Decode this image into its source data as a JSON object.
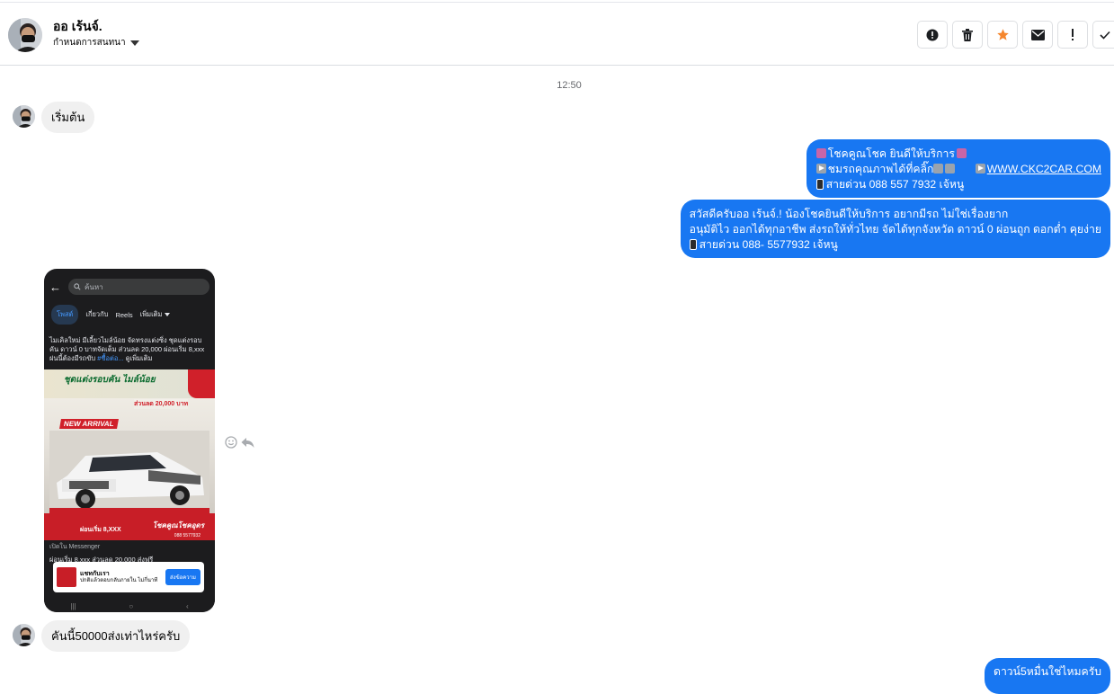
{
  "header": {
    "contact_name": "ออ เร้นจ์.",
    "subtitle": "กำหนดการสนทนา",
    "actions": [
      "report",
      "delete",
      "star",
      "mark-unread",
      "important",
      "done"
    ]
  },
  "timestamp": "12:50",
  "messages": {
    "m1": {
      "text": "เริ่มต้น"
    },
    "m2": {
      "line1": "โชคคูณโชค ยินดีให้บริการ",
      "line2": "ชมรถคุณภาพได้ที่คลิ๊ก",
      "link": "WWW.CKC2CAR.COM",
      "line3": "สายด่วน 088 557 7932 เจ้หนู"
    },
    "m3": {
      "line1": "สวัสดีครับออ เร้นจ์.! น้องโชคยินดีให้บริการ อยากมีรถ ไม่ใช่เรื่องยาก",
      "line2": "อนุมัติไว ออกได้ทุกอาชีพ ส่งรถให้ทั่วไทย จัดได้ทุกจังหวัด ดาวน์ 0  ผ่อนถูก ดอกต่ำ คุยง่าย",
      "line3": "สายด่วน 088- 5577932 เจ้หนู"
    },
    "m4": {
      "search_placeholder": "ค้นหา",
      "tabs": [
        "โพสต์",
        "เกี่ยวกับ",
        "Reels",
        "เพิ่มเติม"
      ],
      "post_text": "ไมเคิลใหม่ มีเลี้ยวไมล์น้อย จัดทรงแต่งซิ่ง ชุดแต่งรอบคัน ดาวน์ 0 บาทจัดเต็ม ส่วนลด 20,000 ผ่อนเริ่ม 8,xxx ฝนนี้ต้องมีรถขับ",
      "post_tag": "#ชื้อต่อ...",
      "see_more": "ดูเพิ่มเติม",
      "ad_title": "ชุดแต่งรอบคัน ไมล์น้อย",
      "ad_new": "NEW ARRIVAL",
      "ad_discount": "ส่วนลด 20,000 บาท",
      "ad_down": "ผ่อนเริ่ม 8,XXX",
      "ad_brand": "โชคคูณโชคอุดร",
      "ad_tel": "088 5577932",
      "open_in": "เปิดใน Messenger",
      "cta_price": "ผ่อนเริ่ม 8,xxx ส่วนลด 20,000 ส่งฟรี",
      "send_btn": "ส่งข้อความ",
      "card_title": "แชทกับเรา",
      "card_sub": "ปกติแล้วตอบกลับภายใน ไม่กี่นาที",
      "card_send": "ส่งข้อความ"
    },
    "m5": {
      "text": "คันนี้50000ส่งเท่าไหร่ครับ"
    },
    "m6": {
      "text": "ดาวน์5หมื่นใช่ไหมครับ"
    }
  }
}
